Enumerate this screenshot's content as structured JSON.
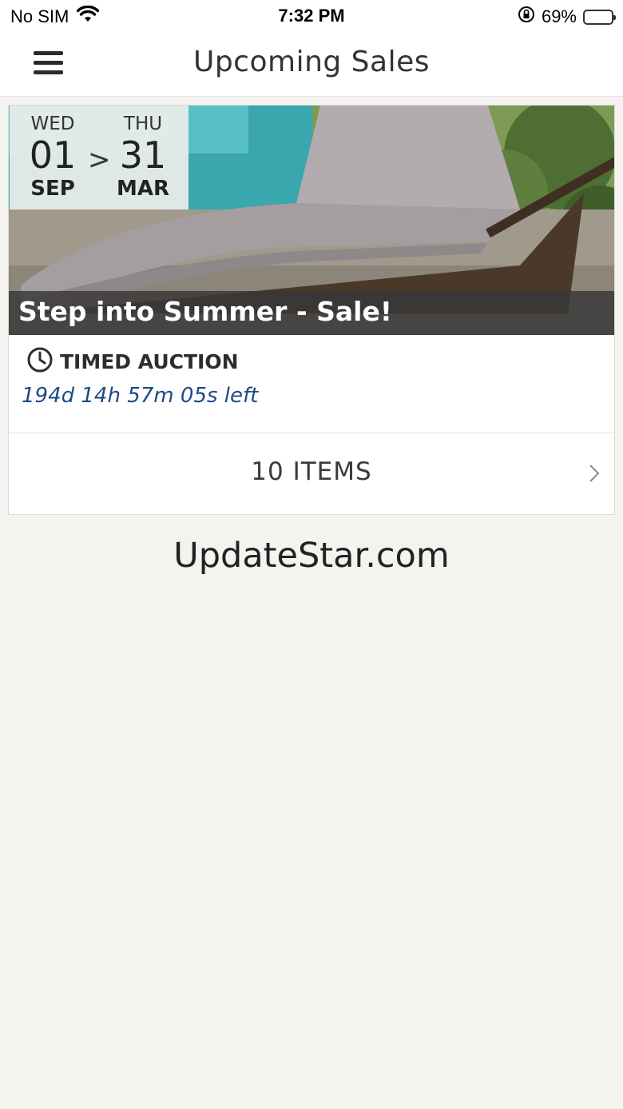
{
  "status_bar": {
    "carrier": "No SIM",
    "time": "7:32 PM",
    "battery_percent": "69%",
    "battery_level": 0.69,
    "icons": [
      "wifi-icon",
      "orientation-lock-icon",
      "battery-icon"
    ]
  },
  "nav": {
    "title": "Upcoming Sales",
    "menu_icon": "hamburger-menu-icon"
  },
  "sale": {
    "start": {
      "weekday": "WED",
      "day": "01",
      "month": "SEP"
    },
    "arrow": ">",
    "end": {
      "weekday": "THU",
      "day": "31",
      "month": "MAR"
    },
    "title": "Step into Summer - Sale!",
    "auction_type": "TIMED AUCTION",
    "auction_icon": "clock-icon",
    "time_left": "194d 14h 57m 05s left",
    "items_label": "10 ITEMS",
    "items_icon": "chevron-right-icon"
  },
  "watermark": "UpdateStar.com",
  "colors": {
    "background": "#f4f3f0",
    "time_left": "#1d4a85",
    "caption_bg": "#373737"
  }
}
